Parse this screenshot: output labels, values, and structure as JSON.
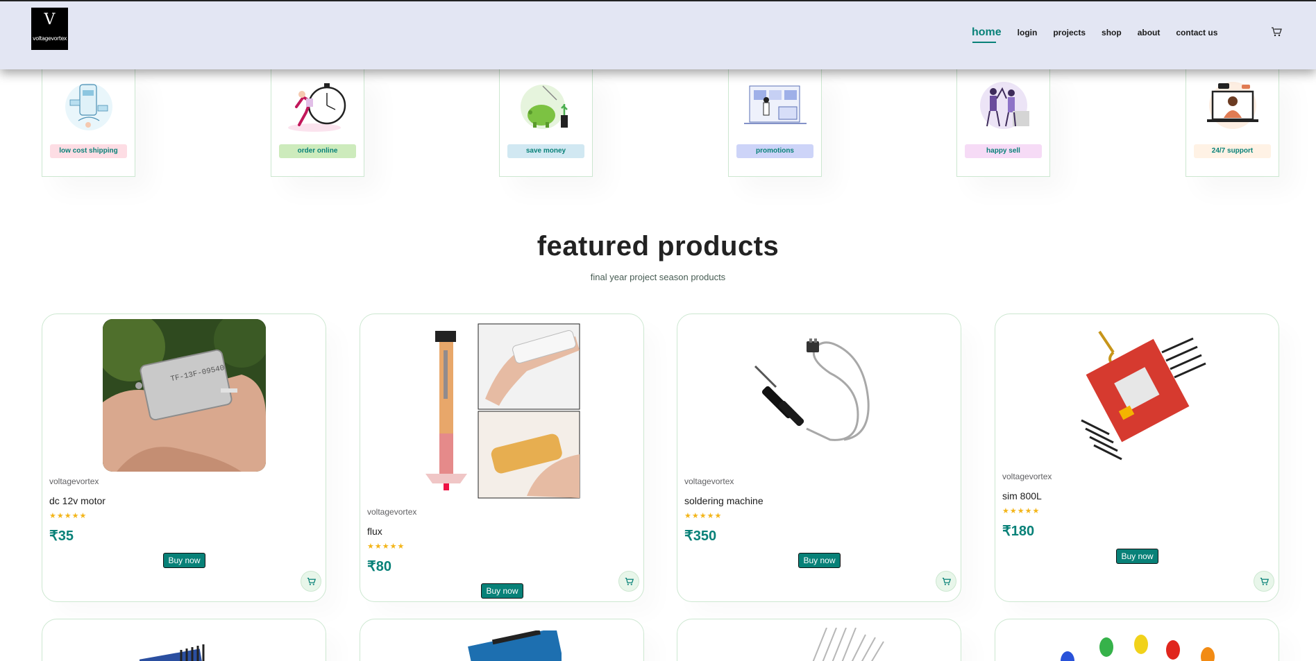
{
  "header": {
    "logo": {
      "glyph": "V",
      "word": "voltagevortex"
    },
    "nav": [
      "home",
      "login",
      "projects",
      "shop",
      "about",
      "contact us"
    ],
    "active": "home"
  },
  "features": [
    {
      "label": "low cost shipping",
      "bg": "#fddde4"
    },
    {
      "label": "order online",
      "bg": "#cdebbc"
    },
    {
      "label": "save money",
      "bg": "#d1e8f2"
    },
    {
      "label": "promotions",
      "bg": "#cdd4f8"
    },
    {
      "label": "happy sell",
      "bg": "#f6dbf6"
    },
    {
      "label": "24/7 support",
      "bg": "#fff2e5"
    }
  ],
  "featured": {
    "title": "featured products",
    "subtitle": "final year project season products"
  },
  "products": [
    {
      "brand": "voltagevortex",
      "name": "dc 12v motor",
      "stars": "★★★★★",
      "price": "₹35",
      "button": "Buy now"
    },
    {
      "brand": "voltagevortex",
      "name": "flux",
      "stars": "★★★★★",
      "price": "₹80",
      "button": "Buy now"
    },
    {
      "brand": "voltagevortex",
      "name": "soldering machine",
      "stars": "★★★★★",
      "price": "₹350",
      "button": "Buy now"
    },
    {
      "brand": "voltagevortex",
      "name": "sim 800L",
      "stars": "★★★★★",
      "price": "₹180",
      "button": "Buy now"
    }
  ],
  "icons": {
    "cart": "cart-icon",
    "star": "star-icon"
  },
  "colors": {
    "accent": "#088178",
    "header_bg": "#e3e6f3",
    "star": "#f3b519",
    "card_border": "#cce7d0"
  }
}
